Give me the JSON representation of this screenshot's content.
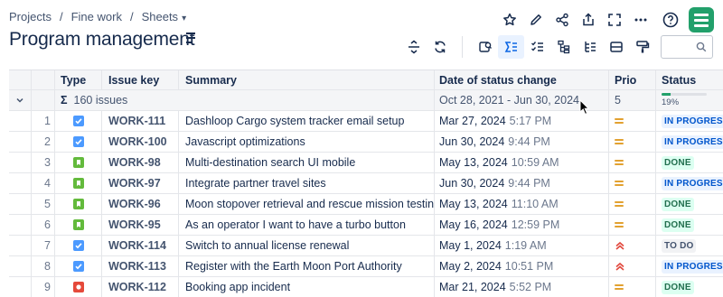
{
  "breadcrumb": {
    "items": [
      "Projects",
      "Fine work",
      "Sheets"
    ],
    "separator": "/"
  },
  "title": "Program management",
  "search": {
    "value": ""
  },
  "columns": {
    "type": "Type",
    "key": "Issue key",
    "summary": "Summary",
    "date": "Date of status change",
    "prio": "Prio",
    "status": "Status"
  },
  "group": {
    "sigma": "Σ",
    "count": "160 issues",
    "date_range": "Oct 28, 2021 - Jun 30, 2024",
    "prio": "5",
    "progress_label": "19%",
    "progress_fraction": 0.19
  },
  "colors": {
    "task": "#4c9aff",
    "story": "#63ba3c",
    "bug": "#e5493a",
    "inprogress_bg": "#e9f2ff",
    "inprogress_fg": "#0055cc",
    "done_bg": "#dcfff1",
    "done_fg": "#216e4e",
    "todo_bg": "#f1f2f4",
    "todo_fg": "#44546f",
    "prio_medium": "#e2a130",
    "prio_high": "#e2483d",
    "accent": "#22a06b"
  },
  "rows": [
    {
      "num": "1",
      "type": "task",
      "key": "WORK-111",
      "summary": "Dashloop Cargo system tracker email setup",
      "date": "Mar 27, 2024",
      "time": "5:17 PM",
      "prio": "medium",
      "status": "IN PROGRESS",
      "status_kind": "inprogress"
    },
    {
      "num": "2",
      "type": "task",
      "key": "WORK-100",
      "summary": "Javascript optimizations",
      "date": "Jun 30, 2024",
      "time": "9:44 PM",
      "prio": "medium",
      "status": "IN PROGRESS",
      "status_kind": "inprogress"
    },
    {
      "num": "3",
      "type": "story",
      "key": "WORK-98",
      "summary": "Multi-destination search UI mobile",
      "date": "May 13, 2024",
      "time": "10:59 AM",
      "prio": "medium",
      "status": "DONE",
      "status_kind": "done"
    },
    {
      "num": "4",
      "type": "story",
      "key": "WORK-97",
      "summary": "Integrate partner travel sites",
      "date": "Jun 30, 2024",
      "time": "9:44 PM",
      "prio": "medium",
      "status": "IN PROGRESS",
      "status_kind": "inprogress"
    },
    {
      "num": "5",
      "type": "story",
      "key": "WORK-96",
      "summary": "Moon stopover retrieval and rescue mission testing",
      "date": "May 13, 2024",
      "time": "11:10 AM",
      "prio": "medium",
      "status": "DONE",
      "status_kind": "done"
    },
    {
      "num": "6",
      "type": "story",
      "key": "WORK-95",
      "summary": "As an operator I want to have a turbo button",
      "date": "May 16, 2024",
      "time": "12:59 PM",
      "prio": "medium",
      "status": "DONE",
      "status_kind": "done"
    },
    {
      "num": "7",
      "type": "task",
      "key": "WORK-114",
      "summary": "Switch to annual license renewal",
      "date": "May 1, 2024",
      "time": "1:19 AM",
      "prio": "high",
      "status": "TO DO",
      "status_kind": "todo"
    },
    {
      "num": "8",
      "type": "task",
      "key": "WORK-113",
      "summary": "Register with the Earth Moon Port Authority",
      "date": "May 2, 2024",
      "time": "10:51 PM",
      "prio": "high",
      "status": "IN PROGRESS",
      "status_kind": "inprogress"
    },
    {
      "num": "9",
      "type": "bug",
      "key": "WORK-112",
      "summary": "Booking app incident",
      "date": "Mar 21, 2024",
      "time": "5:52 PM",
      "prio": "medium",
      "status": "DONE",
      "status_kind": "done"
    }
  ]
}
